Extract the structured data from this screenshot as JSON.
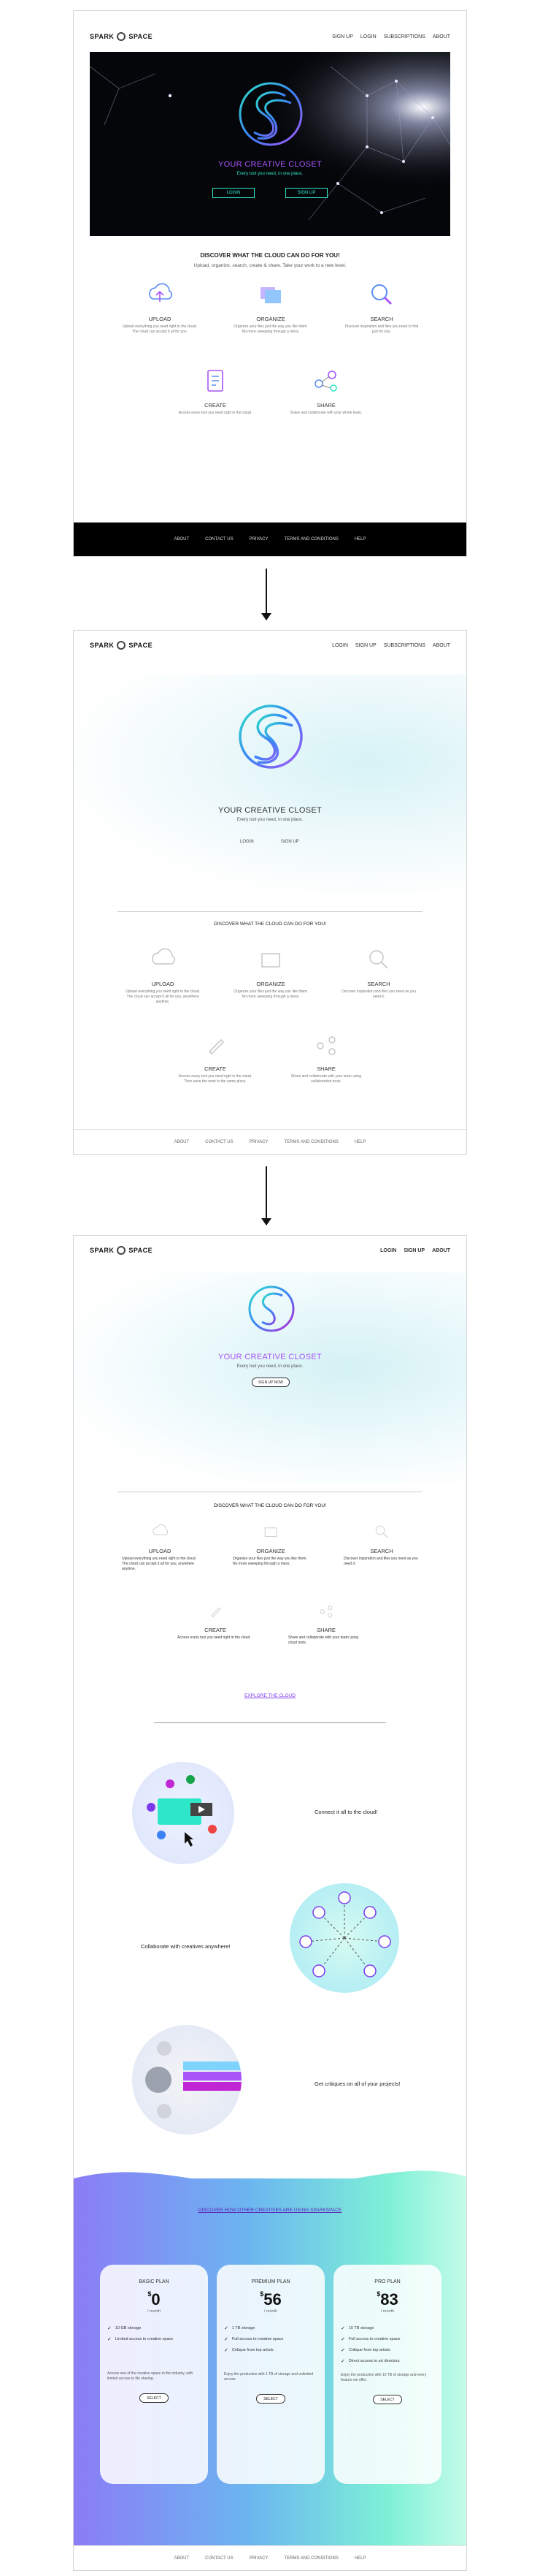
{
  "brand": {
    "left": "SPARK",
    "right": "SPACE"
  },
  "mock1": {
    "nav": [
      "SIGN UP",
      "LOGIN",
      "SUBSCRIPTIONS",
      "ABOUT"
    ],
    "hero_title": "YOUR CREATIVE CLOSET",
    "hero_sub": "Every tool you need, in one place.",
    "login": "LOGIN",
    "signup": "SIGN UP",
    "section_title": "DISCOVER WHAT THE CLOUD CAN DO FOR YOU!",
    "section_sub": "Upload, organize, search, create & share. Take your work to a new level.",
    "features": [
      {
        "name": "UPLOAD",
        "desc": "Upload everything you need right to the cloud. The cloud can accept it all for you."
      },
      {
        "name": "ORGANIZE",
        "desc": "Organize your files just the way you like them. No more sweeping through a mess."
      },
      {
        "name": "SEARCH",
        "desc": "Discover inspiration and files you need to find just for you."
      },
      {
        "name": "CREATE",
        "desc": "Access every tool you need right in the cloud."
      },
      {
        "name": "SHARE",
        "desc": "Share and collaborate with your whole team."
      }
    ],
    "footer": [
      "ABOUT",
      "CONTACT US",
      "PRIVACY",
      "TERMS AND CONDITIONS",
      "HELP"
    ]
  },
  "mock2": {
    "nav": [
      "LOGIN",
      "SIGN UP",
      "SUBSCRIPTIONS",
      "ABOUT"
    ],
    "hero_title": "YOUR CREATIVE CLOSET",
    "hero_sub": "Every tool you need, in one place.",
    "login": "LOGIN",
    "signup": "SIGN UP",
    "section_title": "DISCOVER WHAT THE CLOUD CAN DO FOR YOU!",
    "features": [
      {
        "name": "UPLOAD",
        "desc": "Upload everything you need right to the cloud. The cloud can accept it all for you, anywhere anytime."
      },
      {
        "name": "ORGANIZE",
        "desc": "Organize your files just the way you like them. No more sweeping through a mess."
      },
      {
        "name": "SEARCH",
        "desc": "Discover inspiration and files you need as you need it."
      },
      {
        "name": "CREATE",
        "desc": "Access every tool you need right in the cloud. Then save the work in the same place."
      },
      {
        "name": "SHARE",
        "desc": "Share and collaborate with your team using collaboration tools."
      }
    ],
    "footer": [
      "ABOUT",
      "CONTACT US",
      "PRIVACY",
      "TERMS AND CONDITIONS",
      "HELP"
    ]
  },
  "mock3": {
    "nav": [
      "LOGIN",
      "SIGN UP",
      "ABOUT"
    ],
    "hero_title": "YOUR CREATIVE CLOSET",
    "hero_sub": "Every tool you need, in one place.",
    "cta": "SIGN UP NOW",
    "section_title": "DISCOVER WHAT THE CLOUD CAN DO FOR YOU!",
    "features": [
      {
        "name": "UPLOAD",
        "desc": "Upload everything you need right to the cloud. The cloud can accept it all for you, anywhere anytime."
      },
      {
        "name": "ORGANIZE",
        "desc": "Organize your files just the way you like them. No more sweeping through a mess."
      },
      {
        "name": "SEARCH",
        "desc": "Discover inspiration and files you need as you need it."
      },
      {
        "name": "CREATE",
        "desc": "Access every tool you need right in the cloud."
      },
      {
        "name": "SHARE",
        "desc": "Share and collaborate with your team using cloud tools."
      }
    ],
    "explore_link": "EXPLORE THE CLOUD",
    "services": [
      "Connect it all to the cloud!",
      "Collaborate with creatives anywhere!",
      "Get critiques on all of your projects!"
    ],
    "plans_link": "DISCOVER HOW OTHER CREATIVES ARE USING SPARKSPACE",
    "plans": [
      {
        "name": "BASIC PLAN",
        "price": "0",
        "period": "/ month",
        "items": [
          "10 GB storage",
          "Limited access to creative space"
        ],
        "desc": "Access one of the creative space in the industry, with limited access to file sharing."
      },
      {
        "name": "PREMIUM PLAN",
        "price": "56",
        "period": "/ month",
        "items": [
          "1 TB storage",
          "Full access to creative space",
          "Critique from top artists"
        ],
        "desc": "Enjoy the productive with 1 TB of storage and unlimited access."
      },
      {
        "name": "PRO PLAN",
        "price": "83",
        "period": "/ month",
        "items": [
          "10 TB storage",
          "Full access to creative space",
          "Critique from top artists",
          "Direct access to art directors"
        ],
        "desc": "Enjoy the productive with 10 TB of storage and every feature we offer."
      }
    ],
    "select": "SELECT",
    "footer": [
      "ABOUT",
      "CONTACT US",
      "PRIVACY",
      "TERMS AND CONDITIONS",
      "HELP"
    ]
  },
  "colors": {
    "accent": "#7c3aed",
    "teal": "#2ee6c8",
    "dark": "#05060a"
  }
}
